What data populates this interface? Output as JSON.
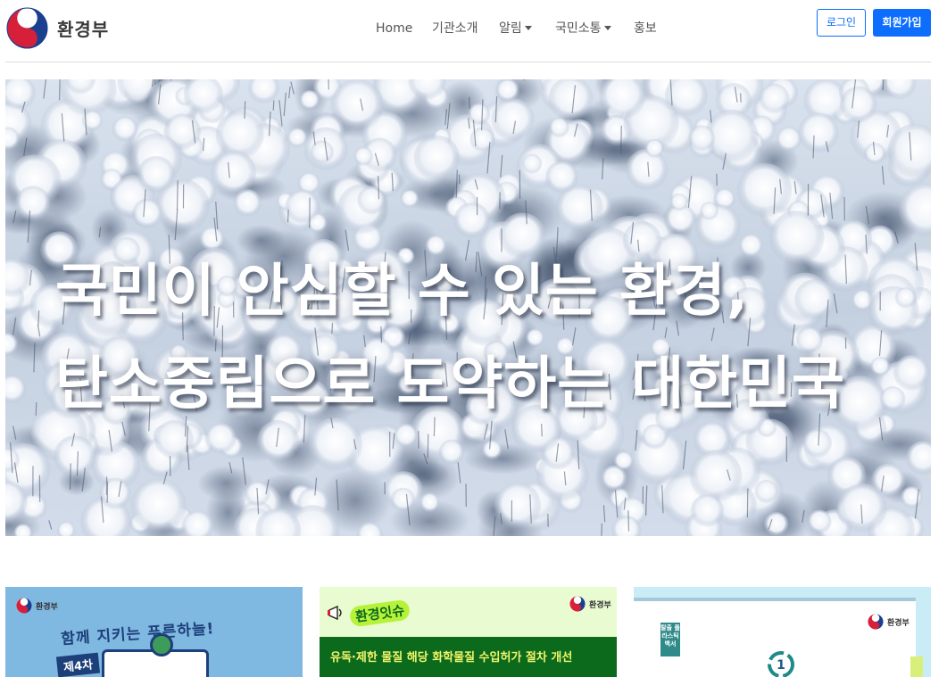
{
  "header": {
    "brand": "환경부",
    "nav": [
      "Home",
      "기관소개",
      "알림",
      "국민소통",
      "홍보"
    ],
    "login_label": "로그인",
    "signup_label": "회원가입"
  },
  "hero": {
    "line1": "국민이 안심할 수 있는 환경,",
    "line2": "탄소중립으로 도약하는 대한민국"
  },
  "cards": [
    {
      "logo_text": "환경부",
      "headline": "함께 지키는 푸른하늘!",
      "ribbon": "제4차"
    },
    {
      "logo_text": "환경부",
      "badge": "환경잇슈",
      "bar_text": "유독·제한 물질 해당 화학물질 수입허가 절차 개선"
    },
    {
      "logo_text": "환경부",
      "book_text": "탈출 플라스틱 백서",
      "circle_number": "1"
    }
  ],
  "colors": {
    "primary": "#0d6efd",
    "nav_text": "#555555",
    "card1_bg": "#7fb8e0",
    "card2_bg": "#e9fbd0",
    "card2_bar": "#0c6a1c",
    "card3_bg": "#c9ecf7"
  }
}
